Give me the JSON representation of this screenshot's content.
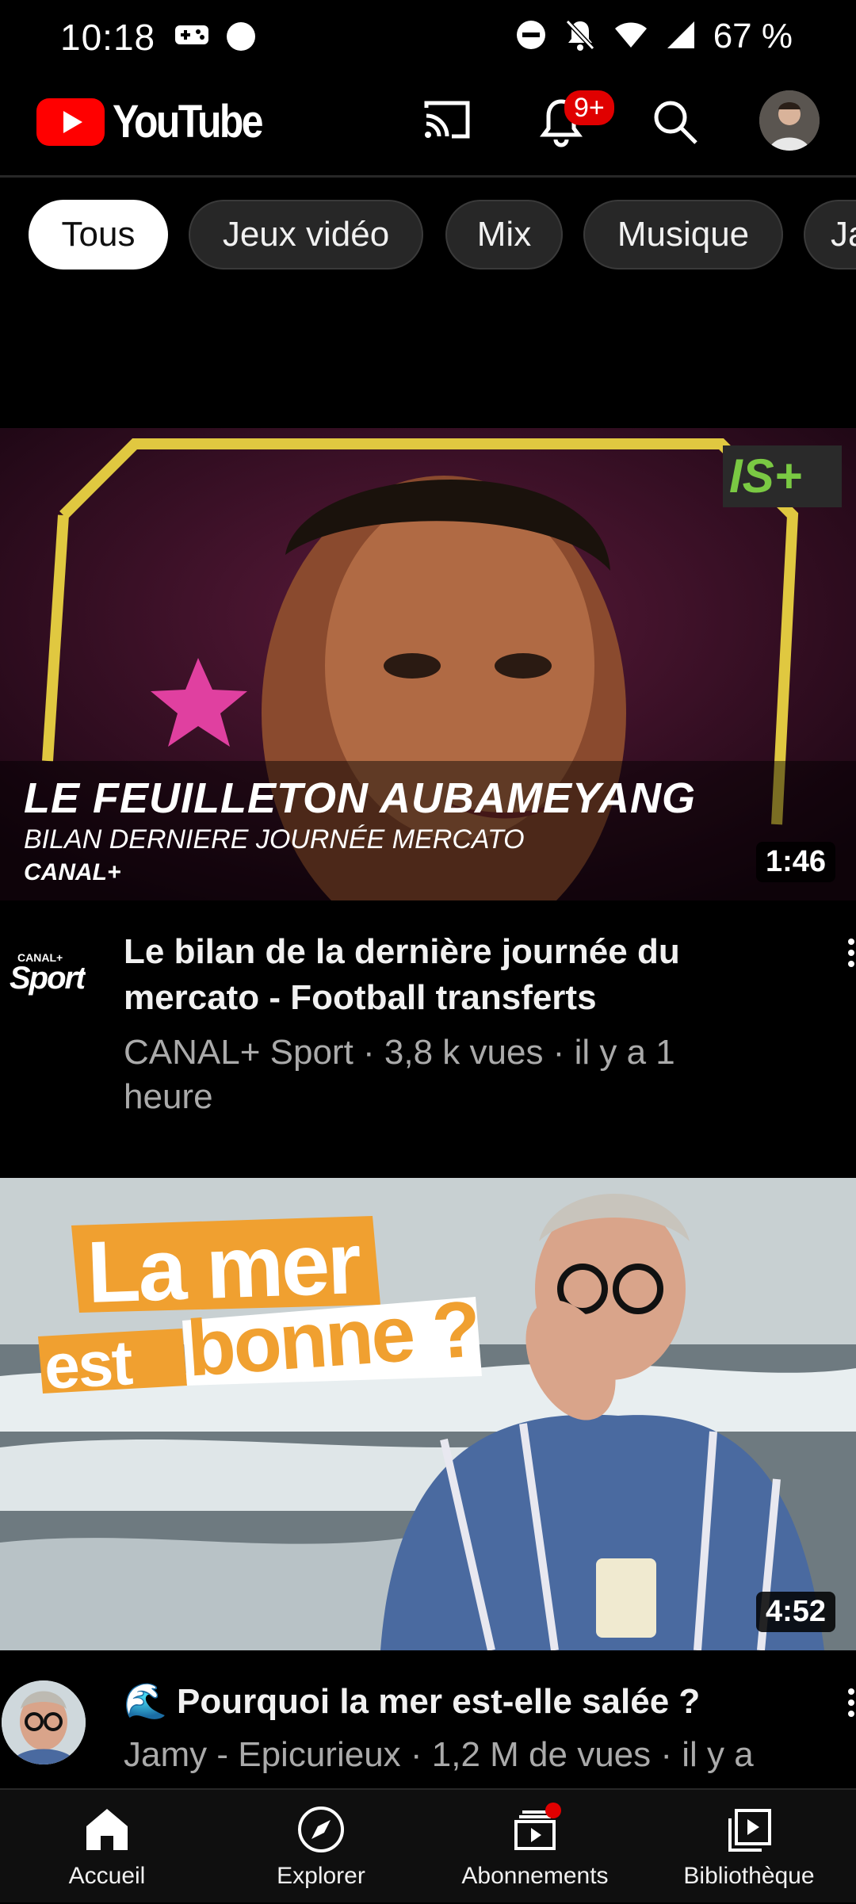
{
  "status_bar": {
    "time": "10:18",
    "battery": "67 %",
    "icons": [
      "gamepad-icon",
      "notification-dot-icon",
      "dnd-icon",
      "bell-off-icon",
      "wifi-icon",
      "signal-icon"
    ]
  },
  "app_bar": {
    "logo_text": "YouTube",
    "notification_badge": "9+",
    "icons": [
      "cast-icon",
      "bell-icon",
      "search-icon",
      "profile-avatar"
    ]
  },
  "chips": [
    {
      "label": "Tous",
      "active": true
    },
    {
      "label": "Jeux vidéo",
      "active": false
    },
    {
      "label": "Mix",
      "active": false
    },
    {
      "label": "Musique",
      "active": false
    },
    {
      "label": "Ja",
      "active": false
    }
  ],
  "videos": [
    {
      "thumb_overlay_title": "LE FEUILLETON AUBAMEYANG",
      "thumb_overlay_subtitle": "BILAN DERNIERE JOURNÉE MERCATO",
      "thumb_overlay_brand": "CANAL+",
      "thumb_corner_logo": "IS+",
      "duration": "1:46",
      "channel_logo_text_top": "CANAL+",
      "channel_logo_text": "Sport",
      "title_line1": "Le bilan de la dernière journée du",
      "title_line2": "mercato - Football transferts",
      "meta_line1": "CANAL+ Sport · 3,8 k vues · il y a 1",
      "meta_line2": "heure"
    },
    {
      "thumb_overlay_line1": "La mer",
      "thumb_overlay_line2a": "est",
      "thumb_overlay_line2b": "bonne ?",
      "duration": "4:52",
      "title_emoji": "🌊",
      "title_line1": "Pourquoi la mer est-elle salée ?",
      "meta_line1": "Jamy - Epicurieux · 1,2 M de vues · il y a"
    }
  ],
  "bottom_nav": [
    {
      "label": "Accueil",
      "icon": "home-icon",
      "active": true
    },
    {
      "label": "Explorer",
      "icon": "compass-icon",
      "active": false
    },
    {
      "label": "Abonnements",
      "icon": "subscriptions-icon",
      "active": false,
      "has_dot": true
    },
    {
      "label": "Bibliothèque",
      "icon": "library-icon",
      "active": false
    }
  ],
  "colors": {
    "background": "#000000",
    "brand_red": "#ff0000",
    "badge_red": "#e00000",
    "chip_bg": "#272727",
    "meta_text": "#aaaaaa"
  }
}
